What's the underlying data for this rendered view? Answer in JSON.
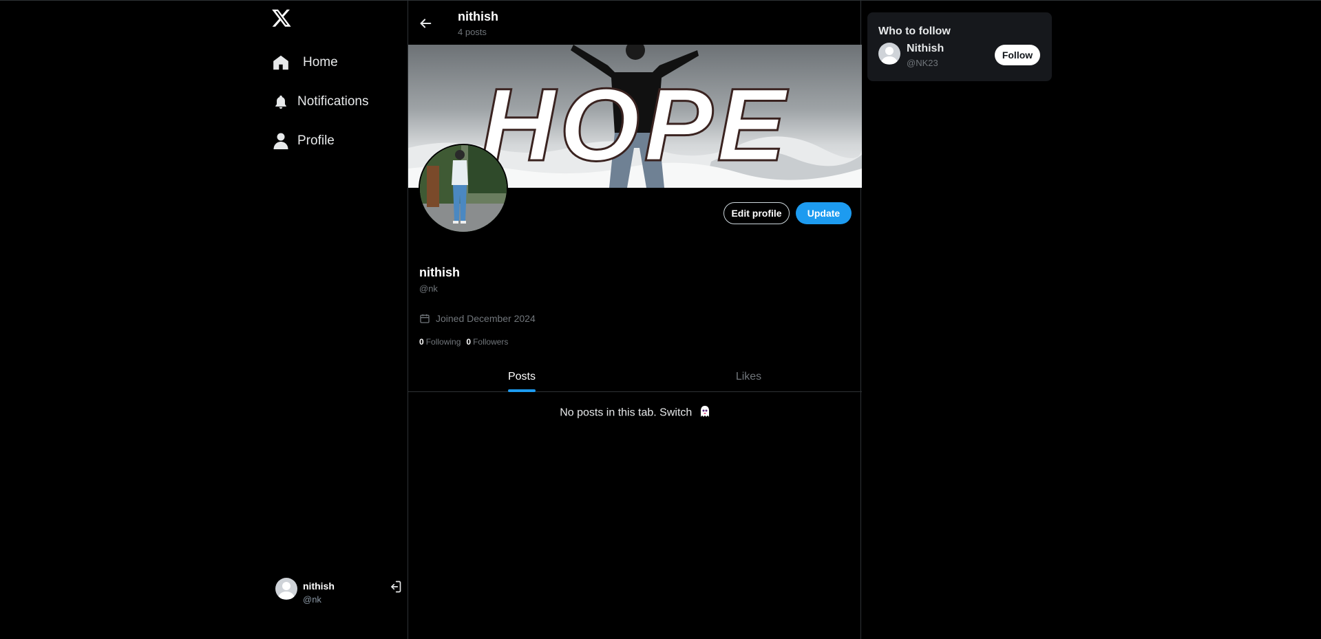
{
  "sidebar": {
    "items": [
      {
        "label": "Home",
        "icon": "home-icon"
      },
      {
        "label": "Notifications",
        "icon": "bell-icon"
      },
      {
        "label": "Profile",
        "icon": "user-icon"
      }
    ],
    "account": {
      "name": "nithish",
      "handle": "@nk"
    }
  },
  "header": {
    "title": "nithish",
    "subtitle": "4 posts"
  },
  "banner": {
    "text": "HOPE"
  },
  "profile": {
    "name": "nithish",
    "handle": "@nk",
    "joined": "Joined December 2024",
    "following_count": "0",
    "following_label": "Following",
    "followers_count": "0",
    "followers_label": "Followers",
    "edit_label": "Edit profile",
    "update_label": "Update"
  },
  "tabs": [
    {
      "label": "Posts"
    },
    {
      "label": "Likes"
    }
  ],
  "empty_text": "No posts in this tab. Switch",
  "who_to_follow": {
    "title": "Who to follow",
    "users": [
      {
        "name": "Nithish",
        "handle": "@NK23",
        "button": "Follow"
      }
    ]
  },
  "colors": {
    "accent": "#1d9bf0",
    "background": "#000000",
    "muted": "#71767b"
  }
}
